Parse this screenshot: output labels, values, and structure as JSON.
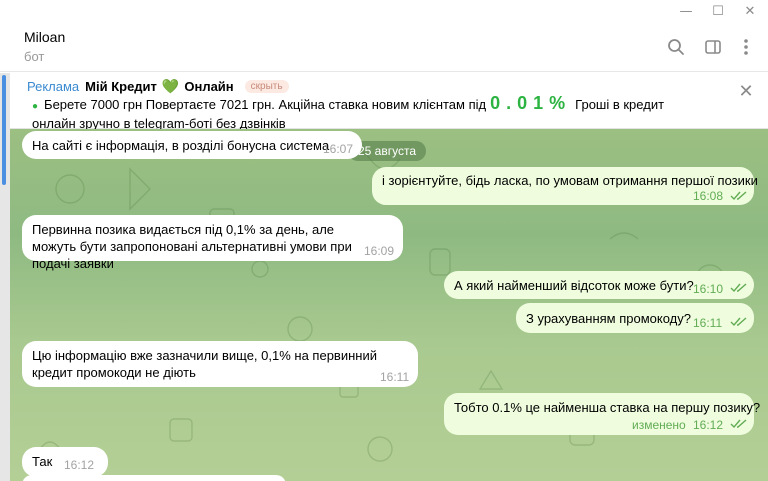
{
  "window": {
    "minimize_glyph": "—",
    "maximize_glyph": "☐",
    "close_glyph": "✕"
  },
  "header": {
    "name": "Miloan",
    "status": "бот"
  },
  "ad": {
    "tag": "Реклама",
    "title": "Мій Кредит",
    "heart": "💚",
    "title_suffix": "Онлайн",
    "hide_label": "скрыть",
    "text_part1": "Берете 7000 грн     Повертаєте 7021 грн. Акційна ставка новим клієнтам під",
    "rate": "0.01%",
    "text_part2": "Гроші в кредит онлайн зручно в telegram-боті без дзвінків",
    "close_glyph": "✕"
  },
  "date_divider": "25 августа",
  "messages": [
    {
      "id": "m1",
      "dir": "in",
      "text": "На сайті є інформація, в розділі бонусна система",
      "time": "16:07"
    },
    {
      "id": "m2",
      "dir": "out",
      "text": "і зорієнтуйте, бідь ласка, по умовам отримання першої позики",
      "time": "16:08",
      "read": true
    },
    {
      "id": "m3",
      "dir": "in",
      "text": "Первинна позика видається під 0,1% за день, але можуть бути запропоновані альтернативні умови при подачі заявки",
      "time": "16:09"
    },
    {
      "id": "m4",
      "dir": "out",
      "text": "А який найменший відсоток може бути?",
      "time": "16:10",
      "read": true
    },
    {
      "id": "m5",
      "dir": "out",
      "text": "З урахуванням промокоду?",
      "time": "16:11",
      "read": true
    },
    {
      "id": "m6",
      "dir": "in",
      "text": "Цю інформацію вже зазначили вище, 0,1% на первинний кредит промокоди не діють",
      "time": "16:11"
    },
    {
      "id": "m7",
      "dir": "out",
      "text": "Тобто 0.1% це найменша ставка на першу позику?",
      "time": "16:12",
      "edited_label": "изменено",
      "read": true
    },
    {
      "id": "m8",
      "dir": "in",
      "text": "Так",
      "time": "16:12"
    }
  ],
  "colors": {
    "accent": "#3a8ad0",
    "ad_green": "#2db342",
    "outgoing_bubble": "#effdde",
    "incoming_bubble": "#ffffff",
    "read_check": "#62ac55"
  }
}
